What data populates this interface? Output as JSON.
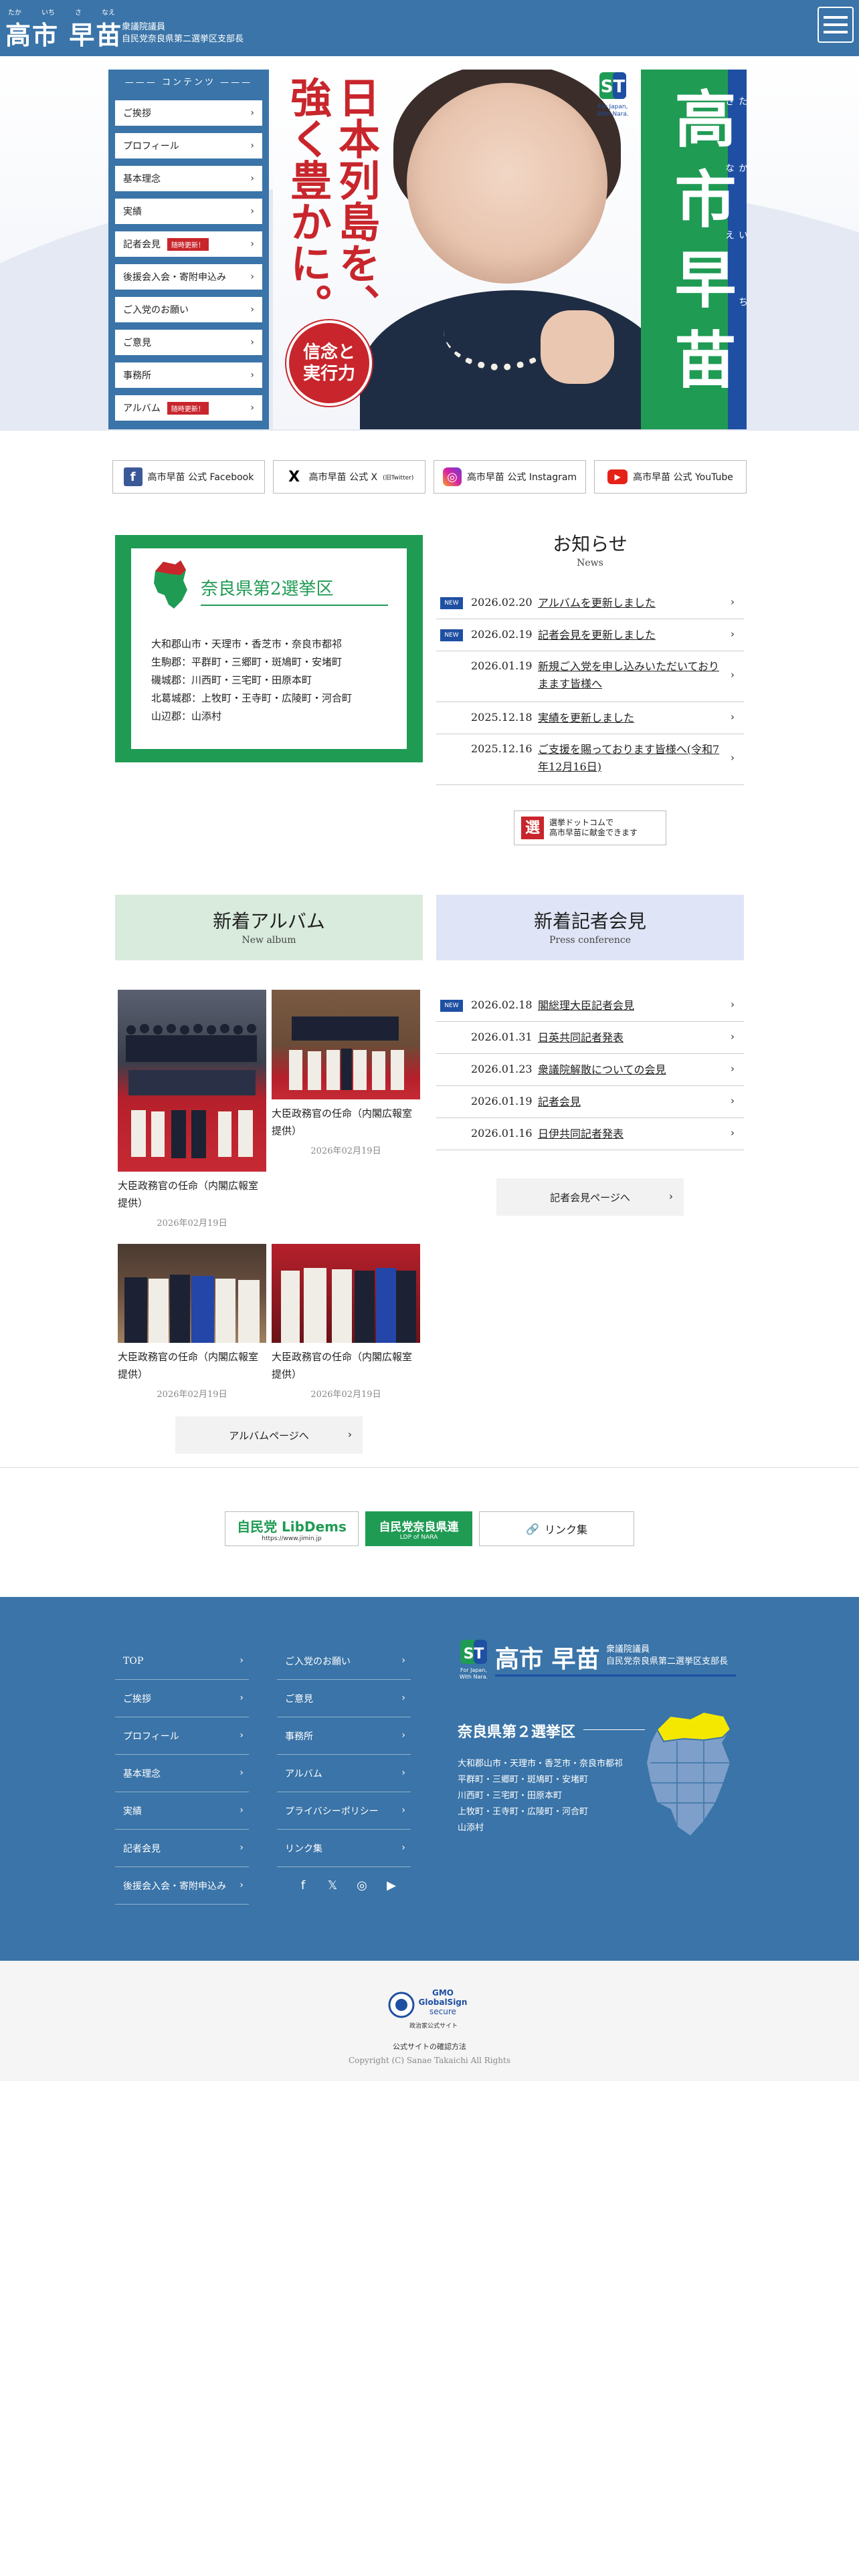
{
  "header": {
    "ruby": [
      "たか",
      "いち",
      "さ",
      "なえ"
    ],
    "name": "高市 早苗",
    "sub_line1": "衆議院議員",
    "sub_line2": "自民党奈良県第二選挙区支部長"
  },
  "sidebar": {
    "heading": "コンテンツ",
    "items": [
      {
        "label": "ご挨拶",
        "badge": ""
      },
      {
        "label": "プロフィール",
        "badge": ""
      },
      {
        "label": "基本理念",
        "badge": ""
      },
      {
        "label": "実績",
        "badge": ""
      },
      {
        "label": "記者会見",
        "badge": "随時更新！"
      },
      {
        "label": "後援会入会・寄附申込み",
        "badge": ""
      },
      {
        "label": "ご入党のお願い",
        "badge": ""
      },
      {
        "label": "ご意見",
        "badge": ""
      },
      {
        "label": "事務所",
        "badge": ""
      },
      {
        "label": "アルバム",
        "badge": "随時更新！"
      }
    ]
  },
  "hero": {
    "slogan_col1": "日本列島を、",
    "slogan_col2": "強く豊かに。",
    "stamp_line1": "信念と",
    "stamp_line2": "実行力",
    "st_logo": "ST",
    "st_caption": "For Japan,\nWith Nara.",
    "name_vertical": "高市早苗",
    "name_ruby": [
      "たか",
      "いち",
      "さ",
      "なえ"
    ]
  },
  "sns": [
    {
      "label": "高市早苗 公式 Facebook",
      "icon": "f",
      "color": "#3b5998"
    },
    {
      "label": "高市早苗 公式 X",
      "suffix": "(旧Twitter)",
      "icon": "X",
      "color": "#000000"
    },
    {
      "label": "高市早苗 公式 Instagram",
      "icon": "◎",
      "color": "#d6249f"
    },
    {
      "label": "高市早苗 公式 YouTube",
      "icon": "▶",
      "color": "#e62117"
    }
  ],
  "district": {
    "title": "奈良県第2選挙区",
    "lines": [
      "大和郡山市・天理市・香芝市・奈良市都祁",
      "生駒郡：平群町・三郷町・斑鳩町・安堵町",
      "磯城郡：川西町・三宅町・田原本町",
      "北葛城郡：上牧町・王寺町・広陵町・河合町",
      "山辺郡：山添村"
    ]
  },
  "news": {
    "title": "お知らせ",
    "subtitle": "News",
    "items": [
      {
        "new": true,
        "date": "2026.02.20",
        "title": "アルバムを更新しました"
      },
      {
        "new": true,
        "date": "2026.02.19",
        "title": "記者会見を更新しました"
      },
      {
        "new": false,
        "date": "2026.01.19",
        "title": "新規ご入党を申し込みいただいておりまます皆様へ"
      },
      {
        "new": false,
        "date": "2025.12.18",
        "title": "実績を更新しました"
      },
      {
        "new": false,
        "date": "2025.12.16",
        "title": "ご支援を賜っております皆様へ(令和7年12月16日)"
      }
    ],
    "new_label": "NEW",
    "donate_icon": "選",
    "donate_line1": "選挙ドットコムで",
    "donate_line2": "高市早苗に献金できます"
  },
  "album": {
    "title": "新着アルバム",
    "subtitle": "New album",
    "items": [
      {
        "caption": "大臣政務官の任命（内閣広報室提供）",
        "date": "2026年02月19日"
      },
      {
        "caption": "大臣政務官の任命（内閣広報室提供）",
        "date": "2026年02月19日"
      },
      {
        "caption": "大臣政務官の任命（内閣広報室提供）",
        "date": "2026年02月19日"
      },
      {
        "caption": "大臣政務官の任命（内閣広報室提供）",
        "date": "2026年02月19日"
      }
    ],
    "button": "アルバムページへ"
  },
  "press": {
    "title": "新着記者会見",
    "subtitle": "Press conference",
    "items": [
      {
        "new": true,
        "date": "2026.02.18",
        "title": "閣総理大臣記者会見"
      },
      {
        "new": false,
        "date": "2026.01.31",
        "title": "日英共同記者発表"
      },
      {
        "new": false,
        "date": "2026.01.23",
        "title": "衆議院解散についての会見"
      },
      {
        "new": false,
        "date": "2026.01.19",
        "title": "記者会見"
      },
      {
        "new": false,
        "date": "2026.01.16",
        "title": "日伊共同記者発表"
      }
    ],
    "button": "記者会見ページへ"
  },
  "links": {
    "jimin_main": "自民党 LibDems",
    "jimin_url": "https://www.jimin.jp",
    "nara_main": "自民党奈良県連",
    "nara_sub": "LDP of NARA",
    "link_label": "リンク集"
  },
  "footer": {
    "col1": [
      "TOP",
      "ご挨拶",
      "プロフィール",
      "基本理念",
      "実績",
      "記者会見",
      "後援会入会・寄附申込み"
    ],
    "col2": [
      "ご入党のお願い",
      "ご意見",
      "事務所",
      "アルバム",
      "プライバシーポリシー",
      "リンク集"
    ],
    "logo_st": "ST",
    "logo_caption": "For Japan,\nWith Nara.",
    "name": "高市 早苗",
    "role1": "衆議院議員",
    "role2": "自民党奈良県第二選挙区支部長",
    "district_title": "奈良県第２選挙区",
    "district_lines": [
      "大和郡山市・天理市・香芝市・奈良市都祁",
      "平群町・三郷町・斑鳩町・安堵町",
      "川西町・三宅町・田原本町",
      "上牧町・王寺町・広陵町・河合町",
      "山添村"
    ],
    "social_icons": [
      "facebook-icon",
      "x-icon",
      "instagram-icon",
      "youtube-icon"
    ]
  },
  "bottom": {
    "gmo_line1": "GMO",
    "gmo_line2": "GlobalSign",
    "gmo_line3": "secure",
    "gmo_line4": "政治家公式サイト",
    "verify": "公式サイトの確認方法",
    "copyright": "Copyright (C) Sanae Takaichi All Rights"
  },
  "colors": {
    "brand_blue": "#3a74a8",
    "green": "#1f9b54",
    "red": "#c8262c",
    "navy": "#1e4fa3"
  }
}
